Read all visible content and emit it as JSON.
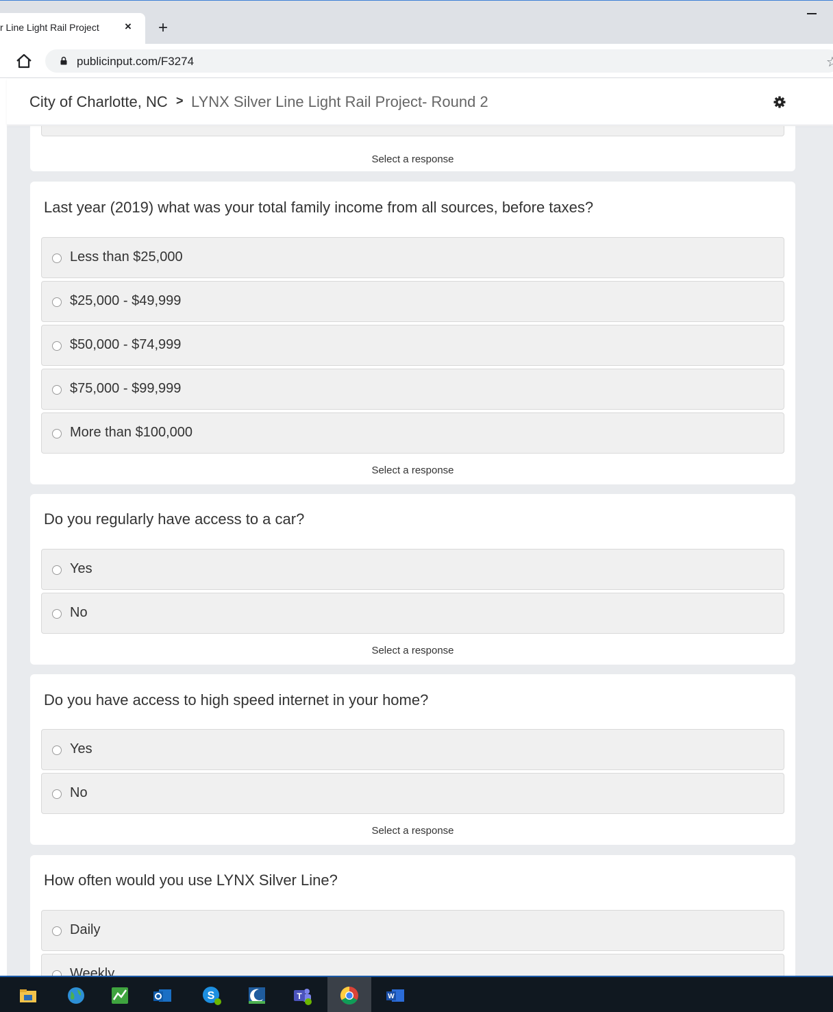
{
  "browser": {
    "tab_title": "r Line Light Rail Project",
    "tab_close": "×",
    "new_tab": "+",
    "url": "publicinput.com/F3274",
    "star": "☆"
  },
  "header": {
    "crumb_root": "City of Charlotte, NC",
    "crumb_sep": ">",
    "crumb_page": "LYNX Silver Line Light Rail Project- Round 2"
  },
  "questions": [
    {
      "hint": "Select a response"
    },
    {
      "text": "Last year (2019) what was your total family income from all sources, before taxes?",
      "options": [
        "Less than $25,000",
        "$25,000 - $49,999",
        "$50,000 - $74,999",
        "$75,000 - $99,999",
        "More than $100,000"
      ],
      "hint": "Select a response"
    },
    {
      "text": "Do you regularly have access to a car?",
      "options": [
        "Yes",
        "No"
      ],
      "hint": "Select a response"
    },
    {
      "text": "Do you have access to high speed internet in your home?",
      "options": [
        "Yes",
        "No"
      ],
      "hint": "Select a response"
    },
    {
      "text": "How often would you use LYNX Silver Line?",
      "options": [
        "Daily",
        "Weekly"
      ]
    }
  ],
  "taskbar": {
    "icons": [
      "file-explorer-icon",
      "globe-icon",
      "project-icon",
      "outlook-icon",
      "skype-icon",
      "moon-app-icon",
      "teams-icon",
      "chrome-icon",
      "word-icon"
    ],
    "active": "chrome-icon"
  },
  "colors": {
    "page_bg": "#e9ebee",
    "option_bg": "#f0f0f0",
    "taskbar": "#101820"
  }
}
